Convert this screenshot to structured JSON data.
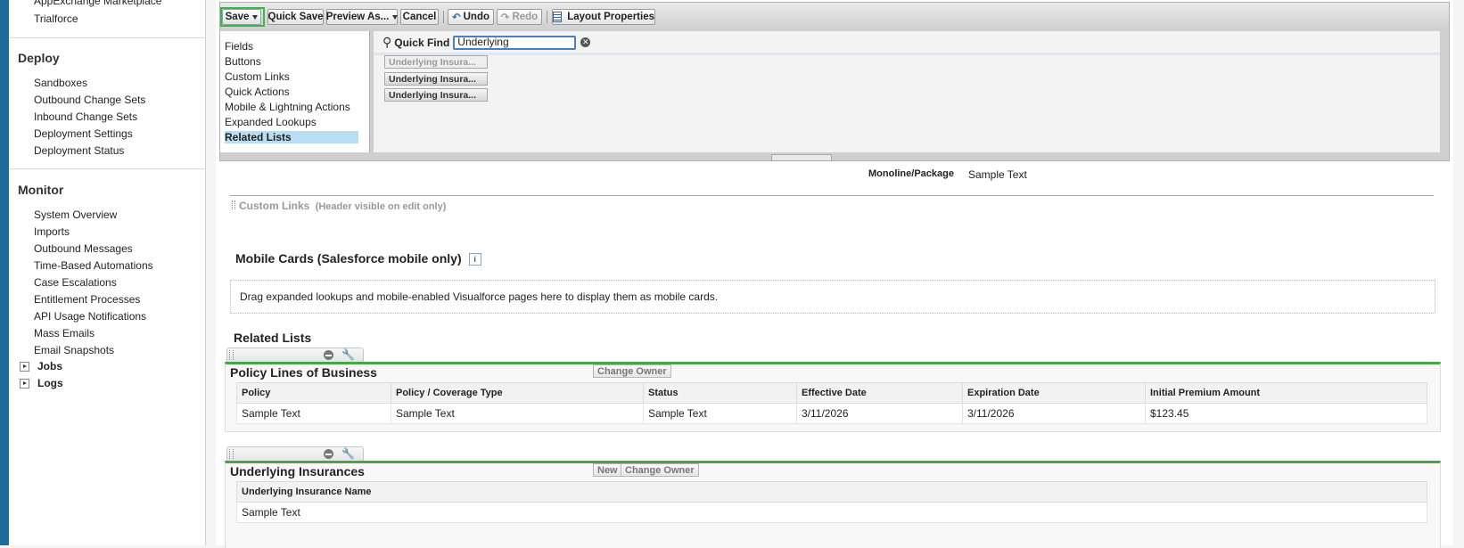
{
  "sidebar": {
    "top_items": [
      "AppExchange Marketplace",
      "Trialforce"
    ],
    "deploy_heading": "Deploy",
    "deploy_items": [
      "Sandboxes",
      "Outbound Change Sets",
      "Inbound Change Sets",
      "Deployment Settings",
      "Deployment Status"
    ],
    "monitor_heading": "Monitor",
    "monitor_items": [
      "System Overview",
      "Imports",
      "Outbound Messages",
      "Time-Based Automations",
      "Case Escalations",
      "Entitlement Processes",
      "API Usage Notifications",
      "Mass Emails",
      "Email Snapshots"
    ],
    "expandable_items": [
      "Jobs",
      "Logs"
    ]
  },
  "toolbar": {
    "save": "Save",
    "quick_save": "Quick Save",
    "preview_as": "Preview As...",
    "cancel": "Cancel",
    "undo": "Undo",
    "redo": "Redo",
    "layout_properties": "Layout Properties"
  },
  "palette": {
    "categories": [
      "Fields",
      "Buttons",
      "Custom Links",
      "Quick Actions",
      "Mobile & Lightning Actions",
      "Expanded Lookups",
      "Related Lists"
    ],
    "selected_category": "Related Lists",
    "quick_find_label": "Quick Find",
    "quick_find_value": "Underlying",
    "results": [
      "Underlying Insura...",
      "Underlying Insura...",
      "Underlying Insura..."
    ]
  },
  "layout": {
    "field_label": "Monoline/Package",
    "field_value": "Sample Text",
    "custom_links_title": "Custom Links",
    "custom_links_note": "(Header visible on edit only)",
    "mobile_cards_title": "Mobile Cards (Salesforce mobile only)",
    "mobile_cards_info": "i",
    "mobile_cards_hint": "Drag expanded lookups and mobile-enabled Visualforce pages here to display them as mobile cards.",
    "related_lists_heading": "Related Lists",
    "related_lists": [
      {
        "title": "Policy Lines of Business",
        "buttons": [
          "Change Owner"
        ],
        "columns": [
          "Policy",
          "Policy / Coverage Type",
          "Status",
          "Effective Date",
          "Expiration Date",
          "Initial Premium Amount"
        ],
        "row": [
          "Sample Text",
          "Sample Text",
          "Sample Text",
          "3/11/2026",
          "3/11/2026",
          "$123.45"
        ]
      },
      {
        "title": "Underlying Insurances",
        "buttons": [
          "New",
          "Change Owner"
        ],
        "columns": [
          "Underlying Insurance Name"
        ],
        "row": [
          "Sample Text"
        ]
      }
    ]
  }
}
